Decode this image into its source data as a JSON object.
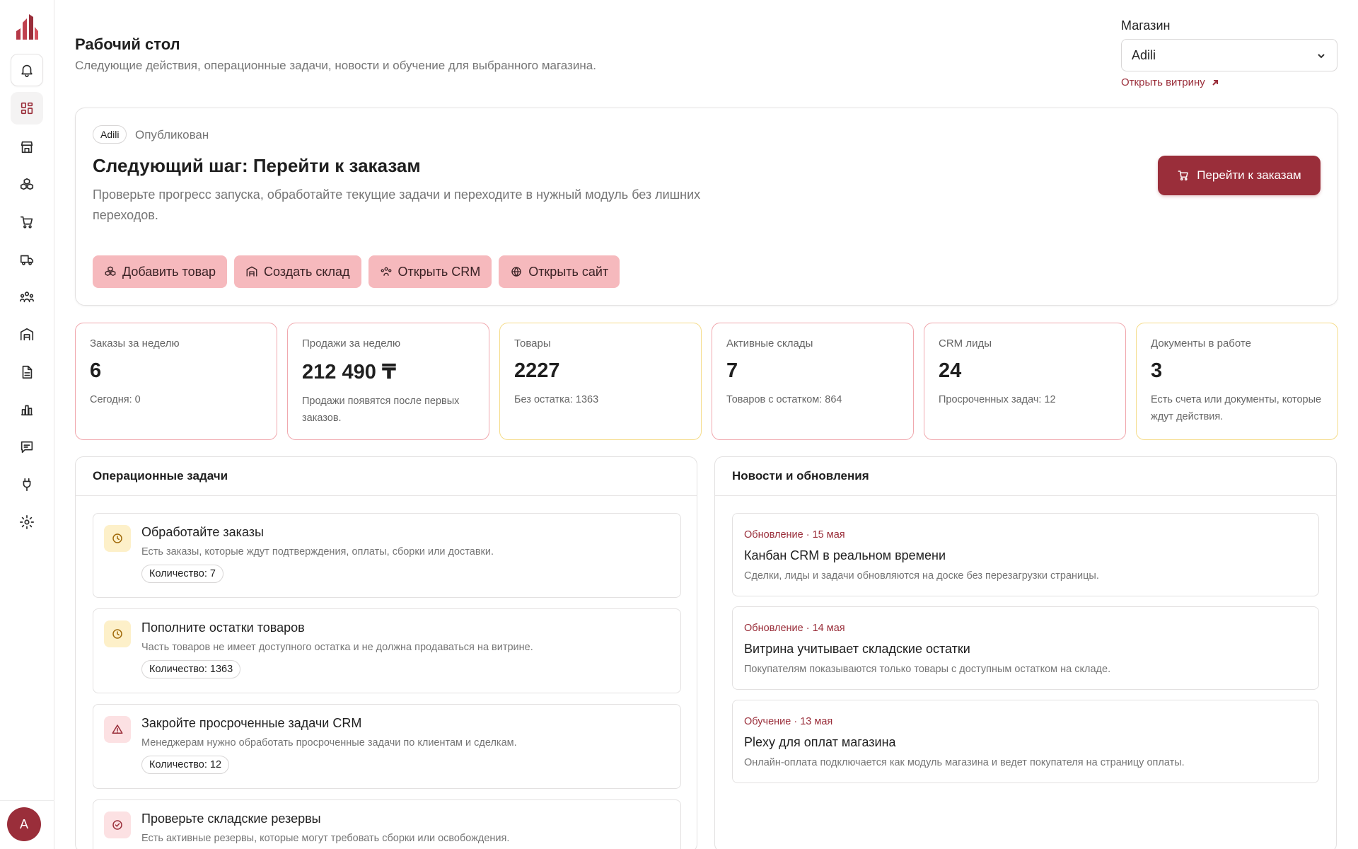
{
  "header": {
    "title": "Рабочий стол",
    "subtitle": "Следующие действия, операционные задачи, новости и обучение для выбранного магазина.",
    "store_label": "Магазин",
    "store_value": "Adili",
    "open_store": "Открыть витрину"
  },
  "sidebar": {
    "items": [
      "bell-icon",
      "dashboard-icon",
      "store-icon",
      "products-icon",
      "cart-icon",
      "truck-icon",
      "crm-icon",
      "warehouse-icon",
      "document-icon",
      "chart-icon",
      "chat-icon",
      "plug-icon",
      "settings-icon"
    ],
    "avatar": "A"
  },
  "hero": {
    "store_chip": "Adili",
    "status": "Опубликован",
    "title": "Следующий шаг: Перейти к заказам",
    "description": "Проверьте прогресс запуска, обработайте текущие задачи и переходите в нужный модуль без лишних переходов.",
    "primary_button": "Перейти к заказам",
    "quick_actions": [
      "Добавить товар",
      "Создать склад",
      "Открыть CRM",
      "Открыть сайт"
    ]
  },
  "stats": [
    {
      "label": "Заказы за неделю",
      "value": "6",
      "note": "Сегодня: 0"
    },
    {
      "label": "Продажи за неделю",
      "value": "212 490 ₸",
      "note": "Продажи появятся после первых заказов."
    },
    {
      "label": "Товары",
      "value": "2227",
      "note": "Без остатка: 1363"
    },
    {
      "label": "Активные склады",
      "value": "7",
      "note": "Товаров с остатком: 864"
    },
    {
      "label": "CRM лиды",
      "value": "24",
      "note": "Просроченных задач: 12"
    },
    {
      "label": "Документы в работе",
      "value": "3",
      "note": "Есть счета или документы, которые ждут действия."
    }
  ],
  "tasks": {
    "title": "Операционные задачи",
    "items": [
      {
        "title": "Обработайте заказы",
        "desc": "Есть заказы, которые ждут подтверждения, оплаты, сборки или доставки.",
        "count": "Количество: 7"
      },
      {
        "title": "Пополните остатки товаров",
        "desc": "Часть товаров не имеет доступного остатка и не должна продаваться на витрине.",
        "count": "Количество: 1363"
      },
      {
        "title": "Закройте просроченные задачи CRM",
        "desc": "Менеджерам нужно обработать просроченные задачи по клиентам и сделкам.",
        "count": "Количество: 12"
      },
      {
        "title": "Проверьте складские резервы",
        "desc": "Есть активные резервы, которые могут требовать сборки или освобождения.",
        "count": ""
      }
    ]
  },
  "news": {
    "title": "Новости и обновления",
    "items": [
      {
        "meta": "Обновление · 15 мая",
        "title": "Канбан CRM в реальном времени",
        "desc": "Сделки, лиды и задачи обновляются на доске без перезагрузки страницы."
      },
      {
        "meta": "Обновление · 14 мая",
        "title": "Витрина учитывает складские остатки",
        "desc": "Покупателям показываются только товары с доступным остатком на складе."
      },
      {
        "meta": "Обучение · 13 мая",
        "title": "Plexy для оплат магазина",
        "desc": "Онлайн-оплата подключается как модуль магазина и ведет покупателя на страницу оплаты."
      }
    ]
  },
  "colors": {
    "accent": "#9a2e3a",
    "quick_bg": "#f6b9bd",
    "stat_border_red": "#f0a8ae",
    "stat_border_yellow": "#f5dc8a"
  }
}
